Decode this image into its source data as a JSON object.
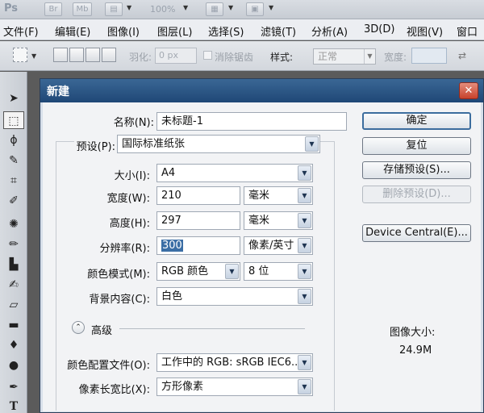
{
  "app": {
    "logo": "Ps",
    "bar_icons": [
      "Br",
      "Mb"
    ],
    "zoom": "100%"
  },
  "menu": [
    "文件(F)",
    "编辑(E)",
    "图像(I)",
    "图层(L)",
    "选择(S)",
    "滤镜(T)",
    "分析(A)",
    "3D(D)",
    "视图(V)",
    "窗口"
  ],
  "options": {
    "feather_label": "羽化:",
    "feather_value": "0 px",
    "antialias_label": "消除锯齿",
    "style_label": "样式:",
    "style_value": "正常",
    "width_label": "宽度:"
  },
  "tools": [
    "move-tool",
    "marquee-tool",
    "lasso-tool",
    "quick-select-tool",
    "crop-tool",
    "eyedropper-tool",
    "spot-heal-tool",
    "brush-tool",
    "stamp-tool",
    "history-brush-tool",
    "eraser-tool",
    "gradient-tool",
    "blur-tool",
    "dodge-tool",
    "pen-tool",
    "type-tool"
  ],
  "dialog": {
    "title": "新建",
    "name_label": "名称(N):",
    "name_value": "未标题-1",
    "preset_label": "预设(P):",
    "preset_value": "国际标准纸张",
    "size_label": "大小(I):",
    "size_value": "A4",
    "width_label": "宽度(W):",
    "width_value": "210",
    "width_unit": "毫米",
    "height_label": "高度(H):",
    "height_value": "297",
    "height_unit": "毫米",
    "resolution_label": "分辨率(R):",
    "resolution_value": "300",
    "resolution_unit": "像素/英寸",
    "color_mode_label": "颜色模式(M):",
    "color_mode_value": "RGB 颜色",
    "bit_depth_value": "8 位",
    "background_label": "背景内容(C):",
    "background_value": "白色",
    "advanced_label": "高级",
    "color_profile_label": "颜色配置文件(O):",
    "color_profile_value": "工作中的 RGB: sRGB IEC6...",
    "pixel_aspect_label": "像素长宽比(X):",
    "pixel_aspect_value": "方形像素",
    "buttons": {
      "ok": "确定",
      "reset": "复位",
      "save_preset": "存储预设(S)...",
      "delete_preset": "删除预设(D)...",
      "device_central": "Device Central(E)..."
    },
    "image_size_label": "图像大小:",
    "image_size_value": "24.9M"
  }
}
